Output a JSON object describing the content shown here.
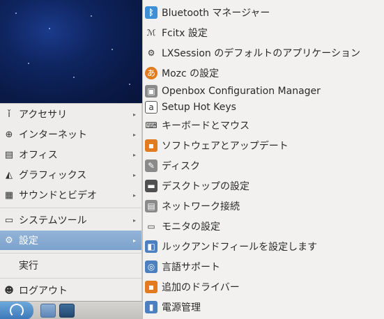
{
  "main_menu": {
    "items": [
      {
        "label": "アクセサリ",
        "icon": "accessories-icon",
        "glyph": "ǐ"
      },
      {
        "label": "インターネット",
        "icon": "globe-icon",
        "glyph": "⊕"
      },
      {
        "label": "オフィス",
        "icon": "document-icon",
        "glyph": "▤"
      },
      {
        "label": "グラフィックス",
        "icon": "graphics-icon",
        "glyph": "◭"
      },
      {
        "label": "サウンドとビデオ",
        "icon": "film-icon",
        "glyph": "▦"
      },
      {
        "label": "システムツール",
        "icon": "monitor-icon",
        "glyph": "▭"
      },
      {
        "label": "設定",
        "icon": "gear-icon",
        "glyph": "⚙"
      },
      {
        "label": "実行"
      },
      {
        "label": "ログアウト",
        "icon": "user-icon",
        "glyph": "☻"
      }
    ],
    "arrow": "▸"
  },
  "submenu": {
    "items": [
      {
        "label": "Bluetooth マネージャー",
        "icon": "bluetooth-icon",
        "glyph": "ᛒ"
      },
      {
        "label": "Fcitx 設定",
        "icon": "fcitx-icon",
        "glyph": "ℳ"
      },
      {
        "label": "LXSession のデフォルトのアプリケーション",
        "icon": "gear-icon",
        "glyph": "⚙"
      },
      {
        "label": "Mozc の設定",
        "icon": "mozc-icon",
        "glyph": "あ"
      },
      {
        "label": "Openbox Configuration Manager",
        "icon": "openbox-icon",
        "glyph": "▣"
      },
      {
        "label": "Setup Hot Keys",
        "icon": "hotkey-icon",
        "glyph": "a"
      },
      {
        "label": "キーボードとマウス",
        "icon": "keyboard-icon",
        "glyph": "⌨"
      },
      {
        "label": "ソフトウェアとアップデート",
        "icon": "software-update-icon",
        "glyph": "▪"
      },
      {
        "label": "ディスク",
        "icon": "disk-icon",
        "glyph": "✎"
      },
      {
        "label": "デスクトップの設定",
        "icon": "desktop-settings-icon",
        "glyph": "▬"
      },
      {
        "label": "ネットワーク接続",
        "icon": "network-icon",
        "glyph": "▤"
      },
      {
        "label": "モニタの設定",
        "icon": "monitor-icon",
        "glyph": "▭"
      },
      {
        "label": "ルックアンドフィールを設定します",
        "icon": "appearance-icon",
        "glyph": "◧"
      },
      {
        "label": "言語サポート",
        "icon": "language-icon",
        "glyph": "◎"
      },
      {
        "label": "追加のドライバー",
        "icon": "driver-icon",
        "glyph": "▪"
      },
      {
        "label": "電源管理",
        "icon": "battery-icon",
        "glyph": "▮"
      }
    ]
  }
}
